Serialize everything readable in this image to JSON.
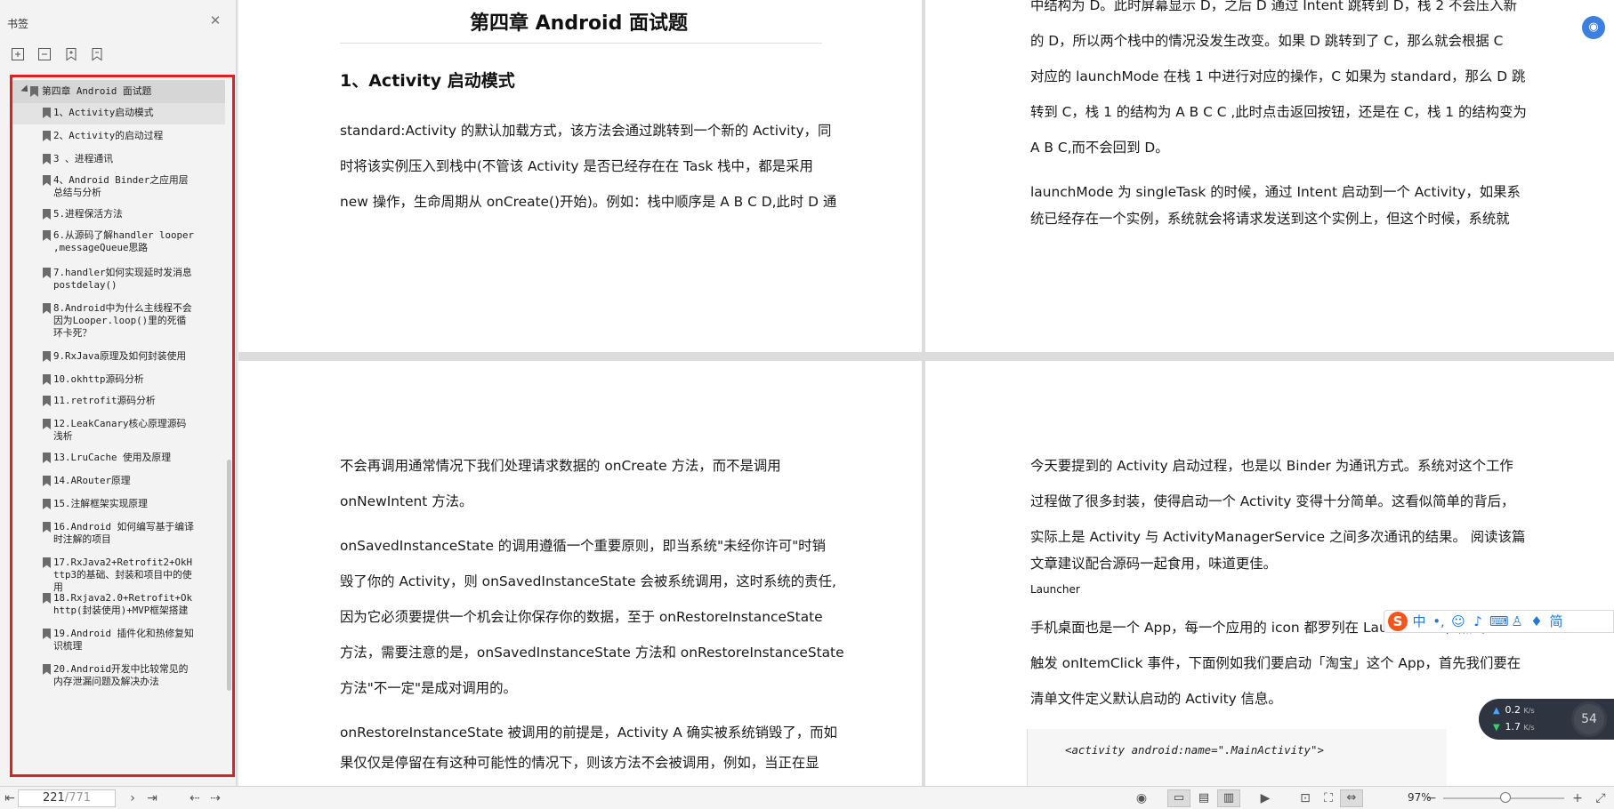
{
  "sidebar": {
    "title": "书签",
    "close_icon": "close-icon",
    "tools": [
      "expand-all-icon",
      "collapse-all-icon",
      "add-bookmark-icon",
      "bookmark-icon"
    ],
    "bookmarks": [
      {
        "label": "第四章 Android 面试题",
        "root": true
      },
      {
        "label": "1、Activity启动模式",
        "selected": true
      },
      {
        "label": "2、Activity的启动过程"
      },
      {
        "label": "3 、进程通讯"
      },
      {
        "label": "4、Android Binder之应用层总结与分析"
      },
      {
        "label": "5.进程保活方法"
      },
      {
        "label": "6.从源码了解handler looper ,messageQueue思路"
      },
      {
        "label": "7.handler如何实现延时发消息postdelay()"
      },
      {
        "label": "8.Android中为什么主线程不会因为Looper.loop()里的死循环卡死？"
      },
      {
        "label": "9.RxJava原理及如何封装使用"
      },
      {
        "label": "10.okhttp源码分析"
      },
      {
        "label": "11.retrofit源码分析"
      },
      {
        "label": "12.LeakCanary核心原理源码浅析"
      },
      {
        "label": "13.LruCache 使用及原理"
      },
      {
        "label": "14.ARouter原理"
      },
      {
        "label": "15.注解框架实现原理"
      },
      {
        "label": "16.Android 如何编写基于编译时注解的项目"
      },
      {
        "label": "17.RxJava2+Retrofit2+OkHttp3的基础、封装和项目中的使用"
      },
      {
        "label": "18.Rxjava2.0+Retrofit+Okhttp(封装使用)+MVP框架搭建"
      },
      {
        "label": "19.Android 插件化和热修复知识梳理"
      },
      {
        "label": "20.Android开发中比较常见的内存泄漏问题及解决办法"
      }
    ]
  },
  "pages": {
    "p1": {
      "chapter_title": "第四章  Android  面试题",
      "section_title": "1、Activity 启动模式",
      "lines": [
        "standard:Activity 的默认加载方式，该方法会通过跳转到一个新的 Activity，同",
        "时将该实例压入到栈中(不管该 Activity 是否已经存在在 Task 栈中，都是采用",
        "new 操作，生命周期从 onCreate()开始)。例如：栈中顺序是 A B C D,此时 D 通"
      ]
    },
    "p2": {
      "lines": [
        "中结构为 D。此时屏幕显示 D，之后 D 通过 Intent 跳转到 D，栈 2 不会压入新",
        "的 D，所以两个栈中的情况没发生改变。如果 D 跳转到了 C，那么就会根据 C",
        "对应的 launchMode 在栈 1 中进行对应的操作，C 如果为 standard，那么 D 跳",
        "转到 C，栈 1 的结构为 A B C C ,此时点击返回按钮，还是在 C，栈 1 的结构变为",
        "A B C,而不会回到 D。",
        "launchMode 为 singleTask 的时候，通过 Intent 启动到一个 Activity，如果系",
        "统已经存在一个实例，系统就会将请求发送到这个实例上，但这个时候，系统就"
      ]
    },
    "p3": {
      "lines": [
        "不会再调用通常情况下我们处理请求数据的 onCreate 方法，而不是调用",
        "onNewIntent 方法。",
        "onSavedInstanceState 的调用遵循一个重要原则，即当系统\"未经你许可\"时销",
        "毁了你的 Activity，则 onSavedInstanceState 会被系统调用，这时系统的责任,",
        "因为它必须要提供一个机会让你保存你的数据，至于 onRestoreInstanceState",
        "方法，需要注意的是，onSavedInstanceState 方法和 onRestoreInstanceState",
        "方法\"不一定\"是成对调用的。",
        "onRestoreInstanceState 被调用的前提是，Activity A 确实被系统销毁了，而如",
        "果仅仅是停留在有这种可能性的情况下，则该方法不会被调用，例如，当正在显"
      ]
    },
    "p4": {
      "lines": [
        "今天要提到的 Activity 启动过程，也是以 Binder 为通讯方式。系统对这个工作",
        "过程做了很多封装，使得启动一个 Activity 变得十分简单。这看似简单的背后，",
        "实际上是 Activity 与 ActivityManagerService 之间多次通讯的结果。 阅读该篇",
        "文章建议配合源码一起食用，味道更佳。"
      ],
      "launcher_label": "Launcher",
      "lines2": [
        "手机桌面也是一个 App，每一个应用的 icon 都罗列在 Launcher 上，点击 icon",
        "触发 onItemClick 事件，下面例如我们要启动「淘宝」这个 App，首先我们要在",
        "清单文件定义默认启动的 Activity 信息。"
      ],
      "code": "<activity android:name=\".MainActivity\">"
    }
  },
  "ime": {
    "logo": "S",
    "lang": "中",
    "icons": [
      "punctuation-icon",
      "emoji-icon",
      "microphone-icon",
      "keyboard-icon",
      "user-icon",
      "skin-icon",
      "simplified-label"
    ],
    "simplified": "简"
  },
  "net": {
    "up": "0.2",
    "up_unit": "K/s",
    "down": "1.7",
    "down_unit": "K/s",
    "percent": "54"
  },
  "status": {
    "current_page": "221",
    "total_pages": "771",
    "zoom": "97%"
  }
}
